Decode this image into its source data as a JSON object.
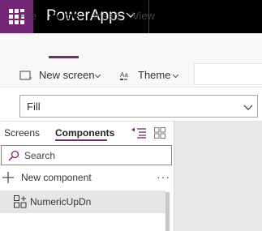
{
  "app": {
    "title": "PowerApps",
    "brand_color": "#742774",
    "waffle_icon": "app-launcher-icon",
    "chevron_icon": "chevron-down-icon"
  },
  "menu": {
    "tabs": [
      {
        "label": "File",
        "active": false
      },
      {
        "label": "Home",
        "active": true
      },
      {
        "label": "Insert",
        "active": false
      },
      {
        "label": "View",
        "active": false
      }
    ]
  },
  "ribbon": {
    "new_screen_label": "New screen",
    "new_screen_icon": "screen-icon",
    "theme_label": "Theme",
    "theme_icon": "theme-icon"
  },
  "property": {
    "selected": "Fill"
  },
  "panel": {
    "tabs": [
      {
        "label": "Screens",
        "active": false
      },
      {
        "label": "Components",
        "active": true
      }
    ],
    "search_placeholder": "Search",
    "new_component_label": "New component",
    "more_label": "···",
    "items": [
      {
        "label": "NumericUpDn",
        "icon": "component-icon",
        "selected": true
      }
    ]
  }
}
